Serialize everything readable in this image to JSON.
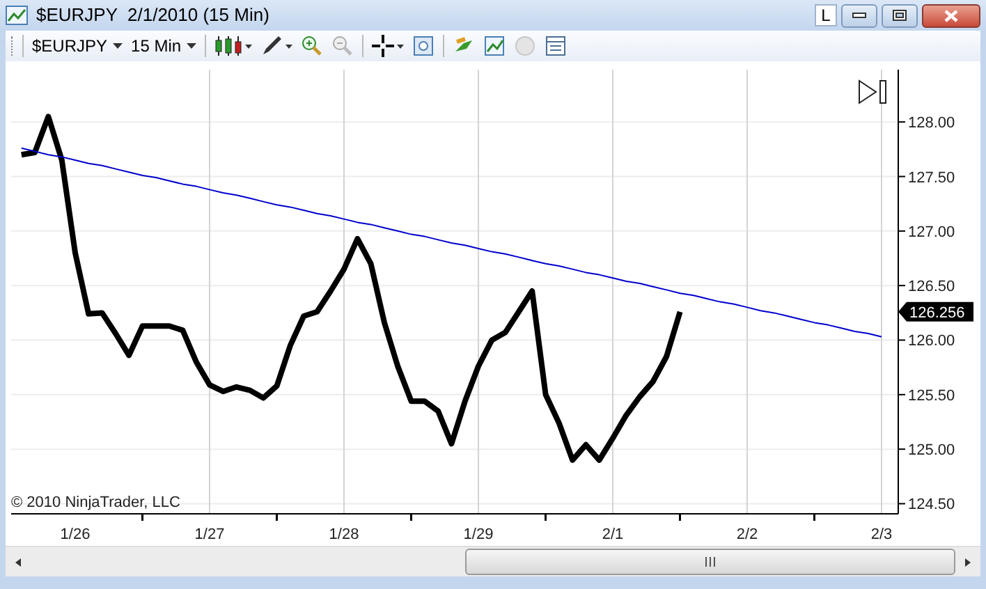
{
  "window": {
    "title": "$EURJPY  2/1/2010 (15 Min)",
    "link_button": "L"
  },
  "toolbar": {
    "instrument": "$EURJPY",
    "interval": "15 Min"
  },
  "chart": {
    "copyright": "© 2010 NinjaTrader, LLC",
    "chart_data": {
      "type": "line",
      "grid": true,
      "ylim": [
        124.42,
        128.48
      ],
      "categories": [
        null,
        null,
        null,
        null,
        "1/26",
        null,
        null,
        null,
        null,
        null,
        null,
        null,
        null,
        null,
        "1/27",
        null,
        null,
        null,
        null,
        null,
        null,
        null,
        null,
        null,
        "1/28",
        null,
        null,
        null,
        null,
        null,
        null,
        null,
        null,
        null,
        "1/29",
        null,
        null,
        null,
        null,
        null,
        null,
        null,
        null,
        null,
        "2/1",
        null,
        null,
        null,
        null,
        null,
        null,
        null,
        null,
        null,
        "2/2",
        null,
        null,
        null,
        null,
        null,
        null,
        null,
        null,
        null,
        "2/3"
      ],
      "series": [
        {
          "color": "#000000",
          "values": [
            127.7,
            127.72,
            128.05,
            127.65,
            126.8,
            126.24,
            126.25,
            126.06,
            125.86,
            126.13,
            126.13,
            126.13,
            126.09,
            125.8,
            125.59,
            125.53,
            125.57,
            125.54,
            125.47,
            125.58,
            125.95,
            126.22,
            126.26,
            126.45,
            126.65,
            126.93,
            126.7,
            126.16,
            125.76,
            125.44,
            125.44,
            125.35,
            125.05,
            125.44,
            125.76,
            126.0,
            126.07,
            126.26,
            126.45,
            125.5,
            125.24,
            124.9,
            125.04,
            124.9,
            125.1,
            125.31,
            125.48,
            125.62,
            125.85,
            126.26,
            null,
            null,
            null,
            null,
            null,
            null,
            null,
            null,
            null,
            null,
            null,
            null,
            null,
            null,
            null
          ]
        },
        {
          "color": "#0000cc",
          "values": [
            127.76,
            127.73,
            127.7,
            127.68,
            127.65,
            127.62,
            127.6,
            127.57,
            127.54,
            127.51,
            127.49,
            127.46,
            127.43,
            127.41,
            127.38,
            127.35,
            127.33,
            127.3,
            127.27,
            127.24,
            127.22,
            127.19,
            127.16,
            127.14,
            127.11,
            127.08,
            127.06,
            127.03,
            127.0,
            126.97,
            126.95,
            126.92,
            126.89,
            126.87,
            126.84,
            126.81,
            126.79,
            126.76,
            126.73,
            126.7,
            126.68,
            126.65,
            126.62,
            126.6,
            126.57,
            126.54,
            126.52,
            126.49,
            126.46,
            126.43,
            126.41,
            126.38,
            126.35,
            126.33,
            126.3,
            126.27,
            126.25,
            126.22,
            126.19,
            126.16,
            126.14,
            126.11,
            126.08,
            126.06,
            126.03
          ]
        }
      ],
      "yticks": [
        {
          "value": 124.5,
          "label": "124.50"
        },
        {
          "value": 125,
          "label": "125.00"
        },
        {
          "value": 125.5,
          "label": "125.50"
        },
        {
          "value": 126,
          "label": "126.00"
        },
        {
          "value": 126.5,
          "label": "126.50"
        },
        {
          "value": 127,
          "label": "127.00"
        },
        {
          "value": 127.5,
          "label": "127.50"
        },
        {
          "value": 128,
          "label": "128.00"
        }
      ],
      "annotations": [
        "126.256"
      ]
    }
  }
}
